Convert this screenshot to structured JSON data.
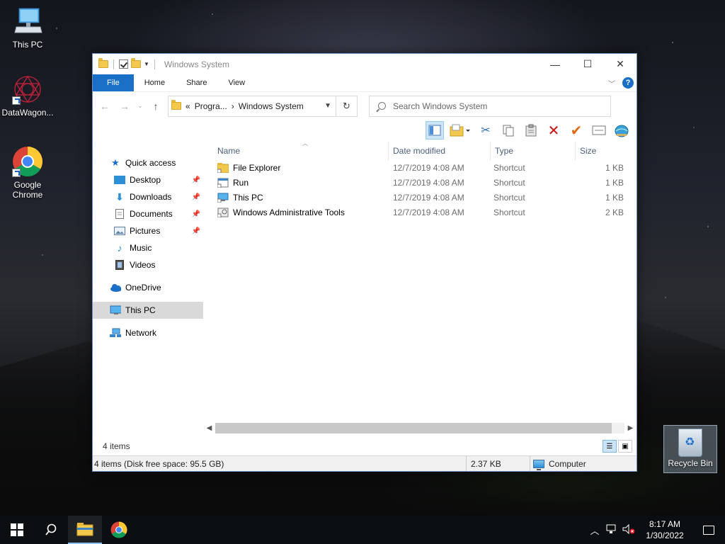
{
  "desktop": {
    "icons": [
      {
        "label": "This PC"
      },
      {
        "label": "DataWagon..."
      },
      {
        "label": "Google\nChrome"
      }
    ],
    "recycle_label": "Recycle Bin"
  },
  "window": {
    "title": "Windows System",
    "controls": {
      "minimize": "—",
      "maximize": "☐",
      "close": "✕"
    },
    "tabs": {
      "file": "File",
      "home": "Home",
      "share": "Share",
      "view": "View"
    },
    "address": {
      "prefix": "«",
      "crumb1": "Progra...",
      "sep": "›",
      "crumb2": "Windows System"
    },
    "search_placeholder": "Search Windows System",
    "nav": {
      "quick_access": "Quick access",
      "desktop": "Desktop",
      "downloads": "Downloads",
      "documents": "Documents",
      "pictures": "Pictures",
      "music": "Music",
      "videos": "Videos",
      "onedrive": "OneDrive",
      "this_pc": "This PC",
      "network": "Network"
    },
    "columns": {
      "name": "Name",
      "date": "Date modified",
      "type": "Type",
      "size": "Size"
    },
    "files": [
      {
        "name": "File Explorer",
        "date": "12/7/2019 4:08 AM",
        "type": "Shortcut",
        "size": "1 KB"
      },
      {
        "name": "Run",
        "date": "12/7/2019 4:08 AM",
        "type": "Shortcut",
        "size": "1 KB"
      },
      {
        "name": "This PC",
        "date": "12/7/2019 4:08 AM",
        "type": "Shortcut",
        "size": "1 KB"
      },
      {
        "name": "Windows Administrative Tools",
        "date": "12/7/2019 4:08 AM",
        "type": "Shortcut",
        "size": "2 KB"
      }
    ],
    "item_count": "4 items",
    "status": {
      "left": "4 items (Disk free space: 95.5 GB)",
      "size": "2.37 KB",
      "location": "Computer"
    }
  },
  "taskbar": {
    "time": "8:17 AM",
    "date": "1/30/2022"
  },
  "colors": {
    "accent": "#1a6fc7",
    "selection": "#cce4f7"
  }
}
